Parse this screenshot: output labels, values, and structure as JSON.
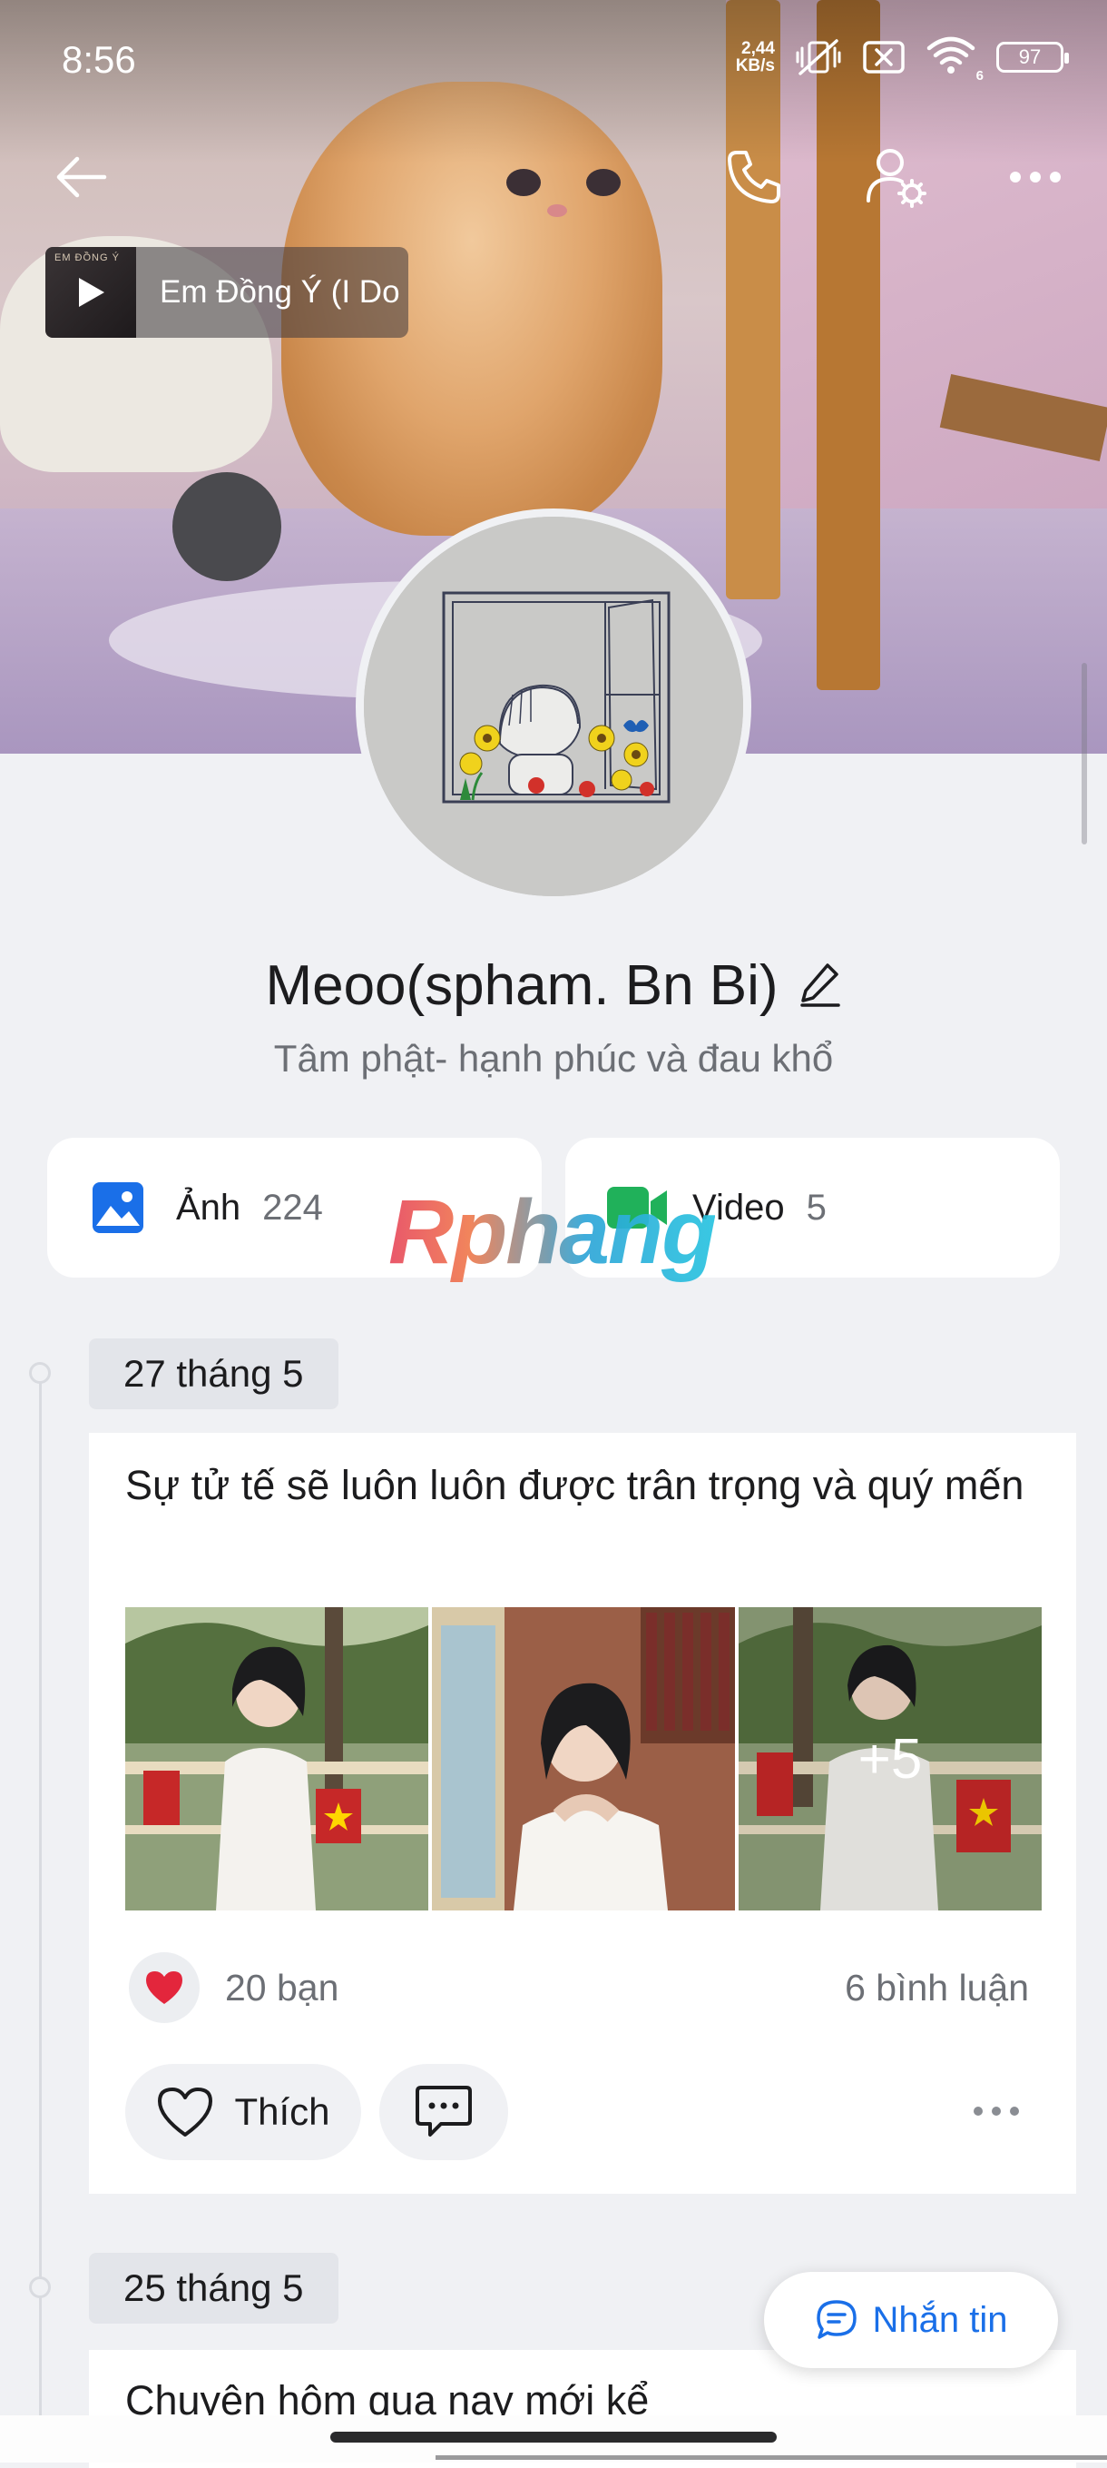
{
  "status_bar": {
    "time": "8:56",
    "net_speed_value": "2,44",
    "net_speed_unit": "KB/s",
    "wifi_badge": "6",
    "battery": "97"
  },
  "header": {
    "icons": [
      "back-arrow-icon",
      "phone-icon",
      "user-settings-icon",
      "more-icon"
    ]
  },
  "music": {
    "thumb_text": "EM ĐỒNG Ý",
    "title": "Em Đồng Ý (I Do"
  },
  "profile": {
    "name": "Meoo(spham. Bn Bi)",
    "bio": "Tâm phật- hạnh phúc và đau khổ"
  },
  "media": {
    "photos_label": "Ảnh",
    "photos_count": "224",
    "videos_label": "Video",
    "videos_count": "5"
  },
  "watermark": "Rphang",
  "posts": [
    {
      "date": "27 tháng 5",
      "text": "Sự tử tế sẽ luôn luôn được trân trọng và quý mến",
      "extra_photos": "+5",
      "reactions": "20 bạn",
      "comments": "6 bình luận",
      "like_label": "Thích"
    },
    {
      "date": "25 tháng 5",
      "text": "Chuyện hôm qua nay mới kể"
    }
  ],
  "message_button": "Nhắn tin",
  "colors": {
    "accent": "#1a6fe8",
    "background": "#f0f1f4",
    "card": "#ffffff",
    "photo_icon": "#1a6fe8",
    "video_icon": "#20b15a",
    "heart": "#e3263c"
  }
}
